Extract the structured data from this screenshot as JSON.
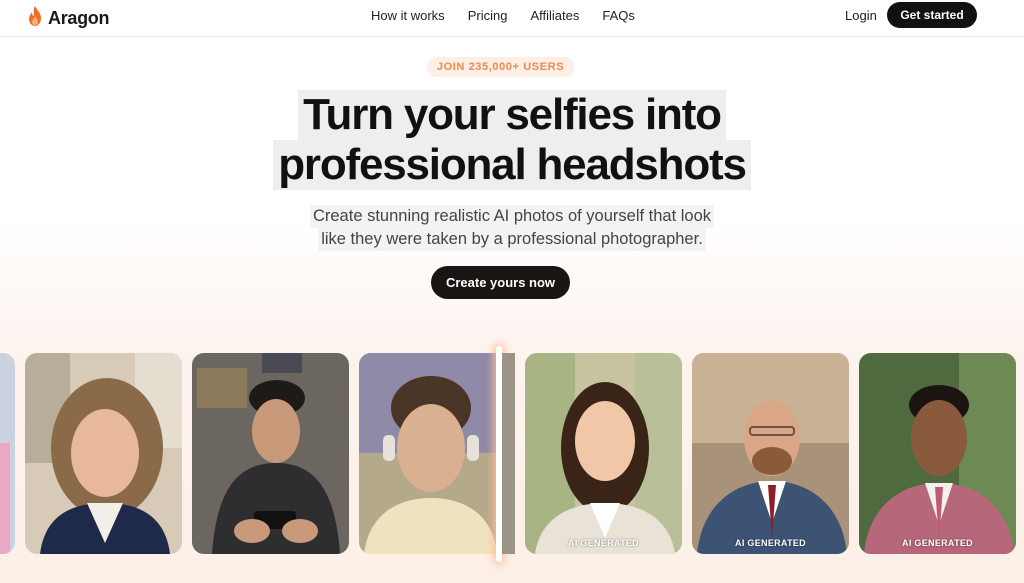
{
  "header": {
    "logo_text": "Aragon",
    "logo_icon": "flame-icon",
    "nav": [
      "How it works",
      "Pricing",
      "Affiliates",
      "FAQs"
    ],
    "login_label": "Login",
    "get_started_label": "Get started"
  },
  "hero": {
    "badge": "JOIN 235,000+ USERS",
    "headline_line1": "Turn your selfies into",
    "headline_line2": "professional headshots",
    "subhead_line1": "Create stunning realistic AI photos of yourself that look",
    "subhead_line2": "like they were taken by a professional photographer.",
    "cta_label": "Create yours now"
  },
  "gallery": {
    "ai_tag": "AI GENERATED",
    "before_photos": [
      "woman-selfie-photo",
      "man-phone-selfie-photo",
      "man-headphones-selfie-photo"
    ],
    "after_photos": [
      "ai-headshot-woman",
      "ai-headshot-man-glasses",
      "ai-headshot-man-suit"
    ]
  },
  "colors": {
    "accent": "#f08a4b",
    "dark": "#111111",
    "badge_bg": "#fdeee6"
  }
}
